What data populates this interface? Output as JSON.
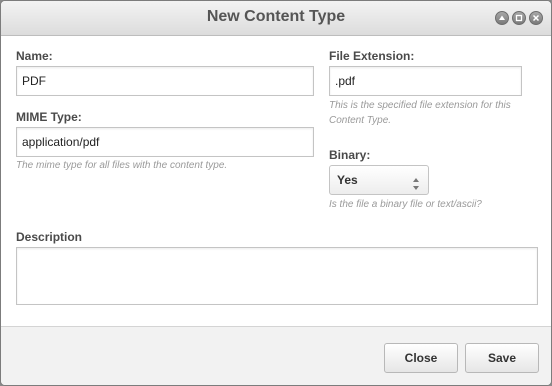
{
  "dialog": {
    "title": "New Content Type"
  },
  "form": {
    "name_label": "Name:",
    "name_value": "PDF",
    "mime_label": "MIME Type:",
    "mime_value": "application/pdf",
    "mime_hint": "The mime type for all files with the content type.",
    "ext_label": "File Extension:",
    "ext_value": ".pdf",
    "ext_hint": "This is the specified file extension for this Content Type.",
    "binary_label": "Binary:",
    "binary_value": "Yes",
    "binary_hint": "Is the file a binary file or text/ascii?",
    "description_label": "Description",
    "description_value": ""
  },
  "footer": {
    "close_label": "Close",
    "save_label": "Save"
  },
  "icons": {
    "window_controls": [
      "collapse-icon",
      "minimize-icon",
      "close-icon"
    ],
    "select_arrows": "updown-arrows-icon"
  }
}
